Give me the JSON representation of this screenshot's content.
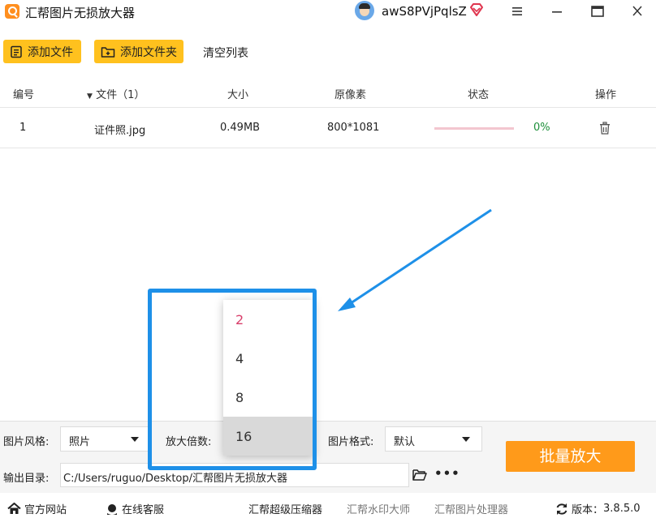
{
  "app": {
    "title": "汇帮图片无损放大器"
  },
  "user": {
    "name": "awS8PVjPqlsZ"
  },
  "toolbar": {
    "add_file": "添加文件",
    "add_folder": "添加文件夹",
    "clear_list": "清空列表"
  },
  "table": {
    "headers": {
      "index": "编号",
      "file": "文件（1）",
      "size": "大小",
      "pixels": "原像素",
      "status": "状态",
      "action": "操作"
    },
    "rows": [
      {
        "index": "1",
        "file": "证件照.jpg",
        "size": "0.49MB",
        "pixels": "800*1081",
        "progress": 0,
        "percent": "0%"
      }
    ]
  },
  "settings": {
    "style_label": "图片风格:",
    "style_value": "照片",
    "scale_label": "放大倍数:",
    "format_label": "图片格式:",
    "format_value": "默认",
    "output_label": "输出目录:",
    "output_value": "C:/Users/ruguo/Desktop/汇帮图片无损放大器",
    "batch_button": "批量放大"
  },
  "scale_dropdown": {
    "options": [
      "2",
      "4",
      "8",
      "16"
    ],
    "selected": "2",
    "hovered": "16"
  },
  "footer": {
    "website": "官方网站",
    "support": "在线客服",
    "compressor": "汇帮超级压缩器",
    "watermark": "汇帮水印大师",
    "image_processor": "汇帮图片处理器",
    "version_label": "版本：",
    "version_value": "3.8.5.0"
  },
  "colors": {
    "accent_yellow": "#ffc11e",
    "batch_orange": "#ff9a1a",
    "highlight_blue": "#1e90e8",
    "progress_pink": "#f3c6cf",
    "percent_green": "#1d8f3a",
    "selected_option": "#d83d6a"
  },
  "icons": {
    "menu": "hamburger-icon",
    "minimize": "minimize-icon",
    "maximize": "maximize-icon",
    "close": "close-icon",
    "delete": "trash-icon",
    "folder": "folder-open-icon",
    "more": "more-dots-icon",
    "home": "home-icon",
    "support": "headset-icon",
    "refresh": "refresh-icon",
    "vip": "diamond-icon"
  }
}
